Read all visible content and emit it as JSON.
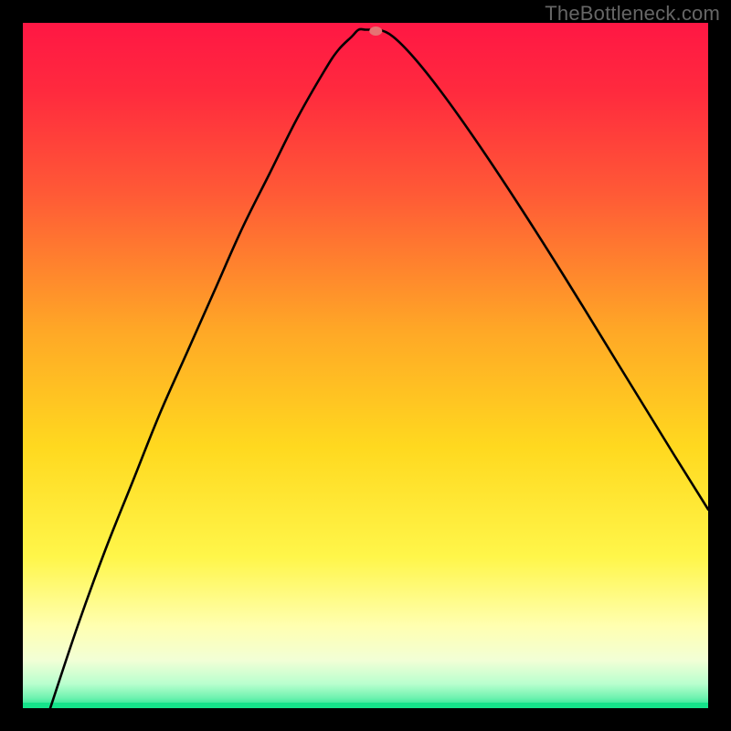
{
  "watermark": "TheBottleneck.com",
  "chart_data": {
    "type": "line",
    "title": "",
    "xlabel": "",
    "ylabel": "",
    "xlim": [
      0,
      100
    ],
    "ylim": [
      0,
      100
    ],
    "background_gradient": {
      "stops": [
        {
          "pos": 0.0,
          "color": "#ff1744"
        },
        {
          "pos": 0.1,
          "color": "#ff2a3e"
        },
        {
          "pos": 0.25,
          "color": "#ff5a36"
        },
        {
          "pos": 0.45,
          "color": "#ffa826"
        },
        {
          "pos": 0.62,
          "color": "#ffd91f"
        },
        {
          "pos": 0.78,
          "color": "#fff64a"
        },
        {
          "pos": 0.88,
          "color": "#ffffb0"
        },
        {
          "pos": 0.93,
          "color": "#f2ffd6"
        },
        {
          "pos": 0.965,
          "color": "#b8ffce"
        },
        {
          "pos": 0.985,
          "color": "#6ef2b0"
        },
        {
          "pos": 1.0,
          "color": "#15e38a"
        }
      ]
    },
    "green_baseline": {
      "y": 99.2,
      "color": "#15e38a",
      "thickness": 6
    },
    "curve": {
      "color": "#000000",
      "thickness": 2.6,
      "x": [
        4,
        8,
        12,
        16,
        20,
        24,
        28,
        32,
        36,
        40,
        44,
        46,
        48,
        49,
        50,
        51,
        52,
        54,
        57,
        61,
        66,
        72,
        79,
        87,
        95,
        100
      ],
      "y": [
        0,
        12,
        23,
        33,
        43,
        52,
        61,
        70,
        78,
        86,
        93,
        96,
        98,
        99,
        99,
        99,
        99,
        98,
        95,
        90,
        83,
        74,
        63,
        50,
        37,
        29
      ]
    },
    "marker": {
      "x": 51.5,
      "y": 98.8,
      "rx": 7,
      "ry": 5,
      "color": "#e57373"
    }
  }
}
